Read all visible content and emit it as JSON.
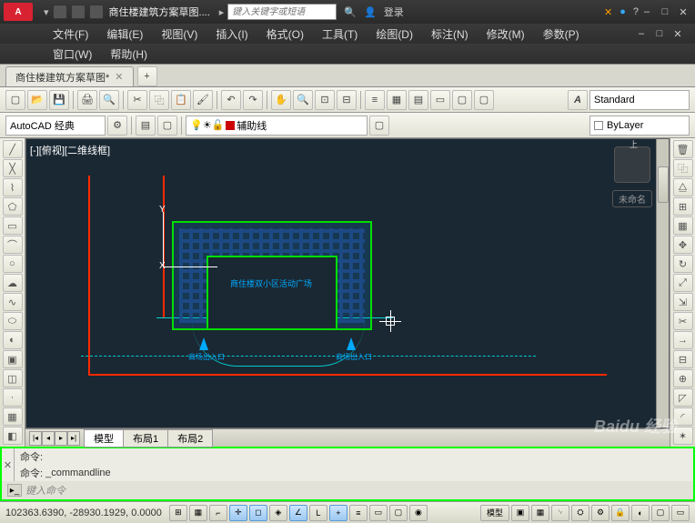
{
  "title": "商住楼建筑方案草图....",
  "search_placeholder": "键入关键字或短语",
  "login_label": "登录",
  "menu1": [
    "文件(F)",
    "编辑(E)",
    "视图(V)",
    "插入(I)",
    "格式(O)",
    "工具(T)",
    "绘图(D)",
    "标注(N)",
    "修改(M)",
    "参数(P)"
  ],
  "menu2": [
    "窗口(W)",
    "帮助(H)"
  ],
  "file_tab": "商住楼建筑方案草图*",
  "style_dd": "Standard",
  "workspace": "AutoCAD 经典",
  "layer_helper": "辅助线",
  "bylayer": "ByLayer",
  "viewport_label": "[-][俯视][二维线框]",
  "plan_caption": "商住楼双小区活动广场",
  "entrance_label": "商场出入口",
  "unnamed": "未命名",
  "layout_tabs": {
    "model": "模型",
    "l1": "布局1",
    "l2": "布局2"
  },
  "cmd": {
    "label1": "命令:",
    "label2": "命令:",
    "current": "_commandline",
    "placeholder": "键入命令"
  },
  "coords": "102363.6390, -28930.1929, 0.0000",
  "status_model": "模型",
  "watermark": "Baidu 经验",
  "ucs": {
    "x": "X",
    "y": "Y"
  },
  "arrow": "▾"
}
